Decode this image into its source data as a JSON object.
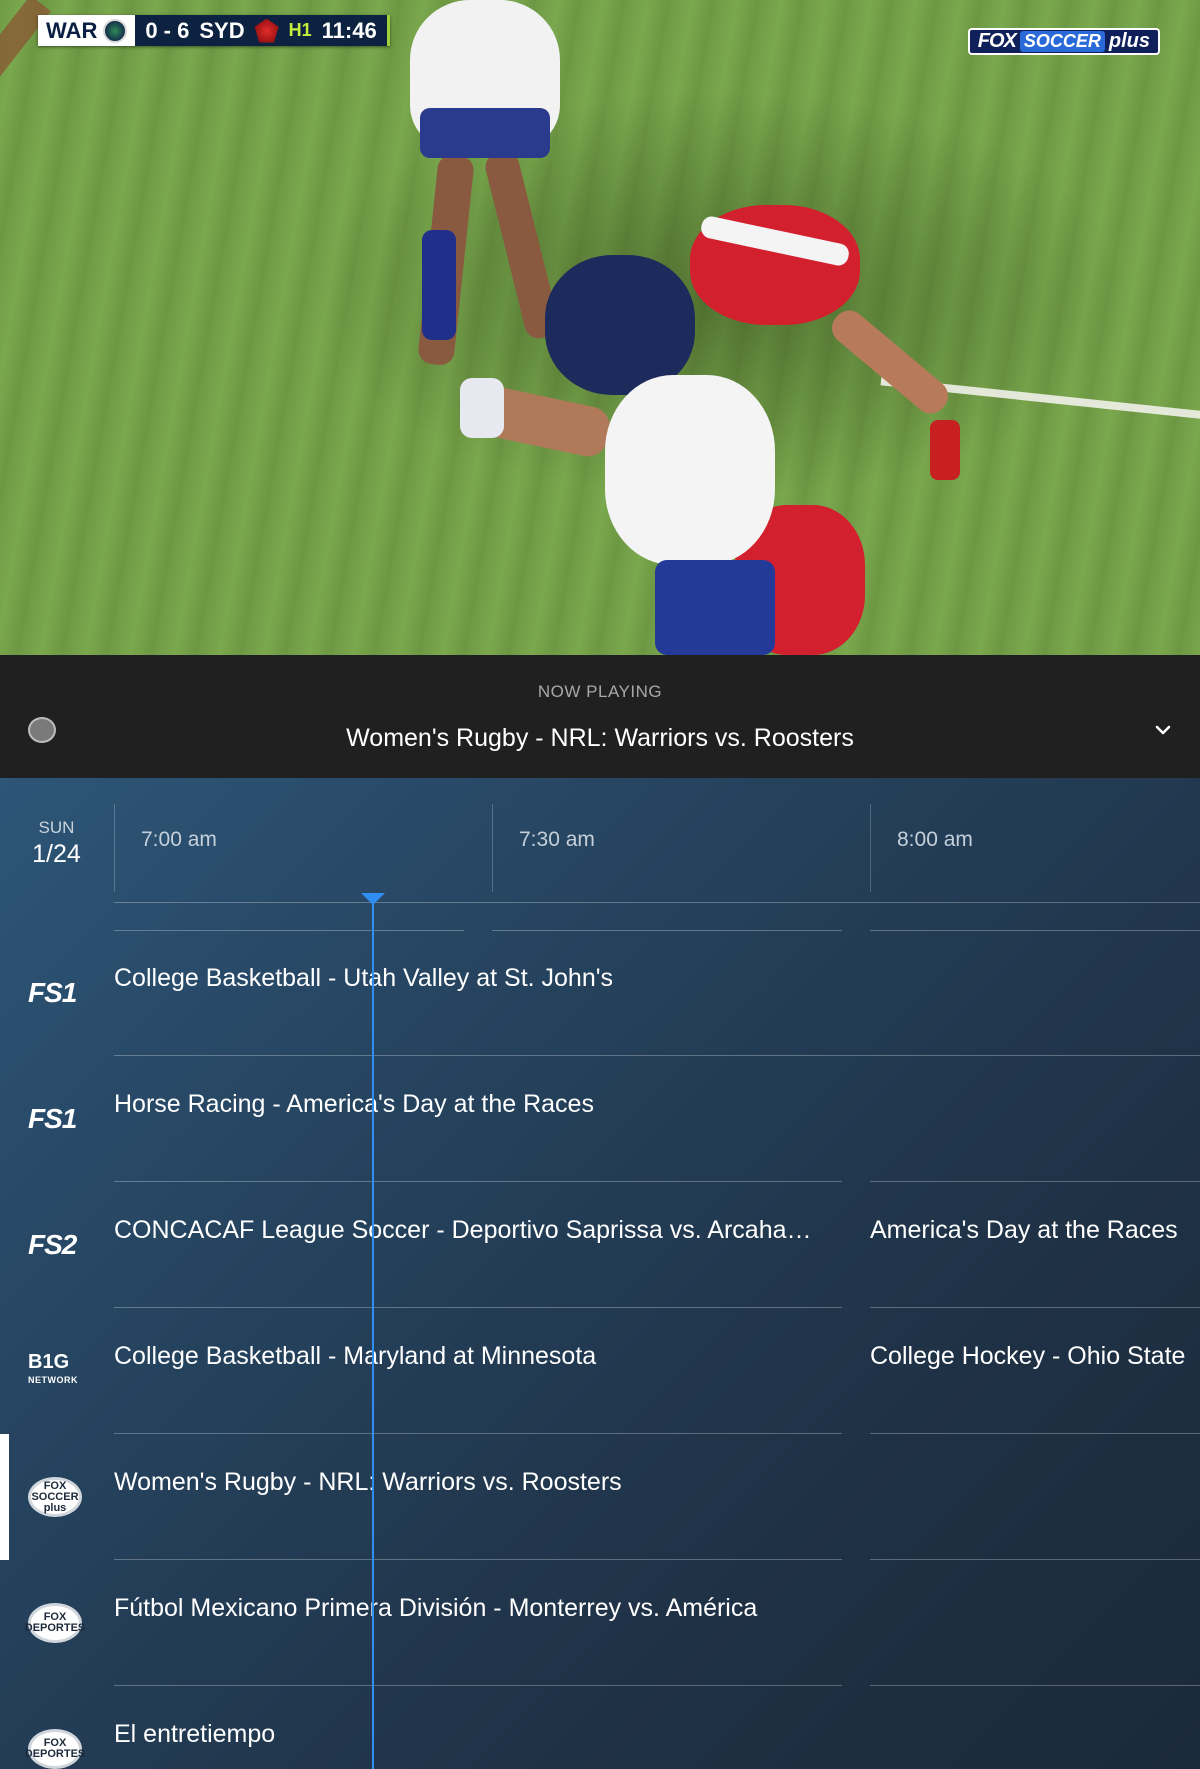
{
  "video": {
    "scoreboard": {
      "home_team": "WAR",
      "score": "0 - 6",
      "away_team": "SYD",
      "period": "H1",
      "clock": "11:46"
    },
    "channel_bug": {
      "fox": "FOX",
      "soccer": "SOCCER",
      "plus": "plus"
    }
  },
  "now_playing": {
    "label": "NOW PLAYING",
    "title": "Women's Rugby - NRL: Warriors vs. Roosters",
    "expand_icon": "chevron-down-icon"
  },
  "guide": {
    "date": {
      "day": "SUN",
      "date": "1/24"
    },
    "time_slots": [
      "7:00 am",
      "7:30 am",
      "8:00 am"
    ],
    "rows": [
      {
        "channel": "FS1",
        "programs": [
          "College Basketball - Utah Valley at St. John's"
        ]
      },
      {
        "channel": "FS1",
        "programs": [
          "Horse Racing - America's Day at the Races"
        ]
      },
      {
        "channel": "FS2",
        "programs": [
          "CONCACAF League Soccer - Deportivo Saprissa vs. Arcaha…",
          "America's Day at the Races"
        ]
      },
      {
        "channel": "B1G",
        "channel_sub": "NETWORK",
        "programs": [
          "College Basketball - Maryland at Minnesota",
          "College Hockey - Ohio State"
        ]
      },
      {
        "channel": "FOX SOCCER plus",
        "programs": [
          "Women's Rugby - NRL: Warriors vs. Roosters"
        ],
        "active": true
      },
      {
        "channel": "FOX DEPORTES",
        "programs": [
          "Fútbol Mexicano Primera División - Monterrey vs. América"
        ]
      },
      {
        "channel": "FOX DEPORTES",
        "programs": [
          "El entretiempo"
        ]
      }
    ]
  },
  "colors": {
    "now_line": "#2f8ef0",
    "guide_bg_start": "#2d5577",
    "guide_bg_end": "#1b2a3b",
    "now_playing_bg": "#202020"
  }
}
